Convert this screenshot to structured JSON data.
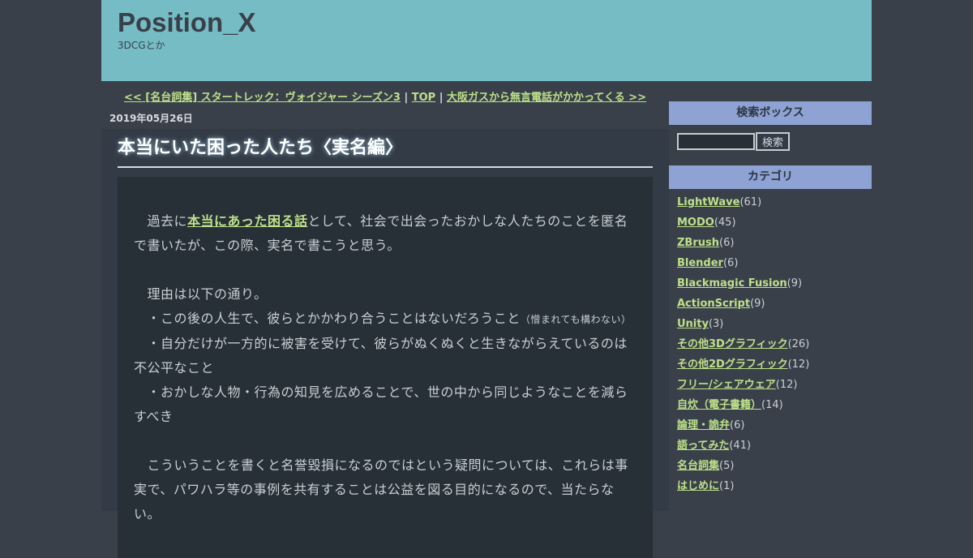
{
  "site": {
    "title": "Position_X",
    "description": "3DCGとか"
  },
  "nav": {
    "prev_marker": "<<",
    "prev_title": "[名台詞集] スタートレック：ヴォイジャー シーズン3",
    "sep1": "|",
    "top": "TOP",
    "sep2": "|",
    "next_title": "大阪ガスから無言電話がかかってくる",
    "next_marker": ">>"
  },
  "entry": {
    "date": "2019年05月26日",
    "title": "本当にいた困った人たち〈実名編〉",
    "p1_pre": "　過去に",
    "p1_link": "本当にあった困る話",
    "p1_post": "として、社会で出会ったおかしな人たちのことを匿名で書いたが、この際、実名で書こうと思う。",
    "p2": "　理由は以下の通り。",
    "p3": "　・この後の人生で、彼らとかかわり合うことはないだろうこと",
    "p3_small": "（憎まれても構わない）",
    "p4": "　・自分だけが一方的に被害を受けて、彼らがぬくぬくと生きながらえているのは不公平なこと",
    "p5": "　・おかしな人物・行為の知見を広めることで、世の中から同じようなことを減らすべき",
    "p6": "　こういうことを書くと名誉毀損になるのではという疑問については、これらは事実で、パワハラ等の事例を共有することは公益を図る目的になるので、当たらない。"
  },
  "sidebar": {
    "search_heading": "検索ボックス",
    "search_value": "",
    "search_button": "検索",
    "category_heading": "カテゴリ",
    "categories": [
      {
        "name": "LightWave",
        "count": "(61)"
      },
      {
        "name": "MODO",
        "count": "(45)"
      },
      {
        "name": "ZBrush",
        "count": "(6)"
      },
      {
        "name": "Blender",
        "count": "(6)"
      },
      {
        "name": "Blackmagic Fusion",
        "count": "(9)"
      },
      {
        "name": "ActionScript",
        "count": "(9)"
      },
      {
        "name": "Unity",
        "count": "(3)"
      },
      {
        "name": "その他3Dグラフィック",
        "count": "(26)"
      },
      {
        "name": "その他2Dグラフィック",
        "count": "(12)"
      },
      {
        "name": "フリー/シェアウェア",
        "count": "(12)"
      },
      {
        "name": "自炊（電子書籍）",
        "count": "(14)"
      },
      {
        "name": "論理・詭弁",
        "count": "(6)"
      },
      {
        "name": "語ってみた",
        "count": "(41)"
      },
      {
        "name": "名台詞集",
        "count": "(5)"
      },
      {
        "name": "はじめに",
        "count": "(1)"
      }
    ]
  },
  "colors": {
    "background": "#3a4049",
    "header": "#75bcc5",
    "link": "#bde08a",
    "sidebar_heading": "#8ea2d3"
  }
}
